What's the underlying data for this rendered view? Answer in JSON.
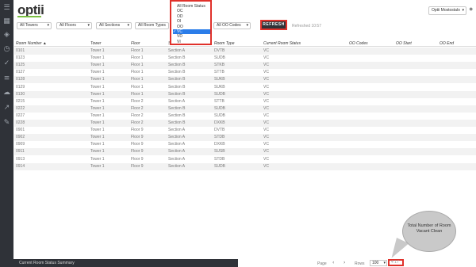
{
  "app": {
    "logo_text": "optii",
    "user_name": "Optii Mostostalo"
  },
  "rail_icons": [
    "menu-icon",
    "grid-icon",
    "layers-icon",
    "clock-icon",
    "check-circle-icon",
    "list-icon",
    "cloud-icon",
    "chart-icon",
    "wrench-icon"
  ],
  "filters": {
    "towers": "All Towers",
    "floors": "All Floors",
    "sections": "All Sections",
    "room_types": "All Room Types",
    "oo_codes": "All OO Codes"
  },
  "refresh": {
    "label": "REFRESH",
    "status": "Refreshed 10:57"
  },
  "room_status_dropdown": {
    "options": [
      "All Room Status",
      "OC",
      "OD",
      "OI",
      "OO",
      "VC",
      "VD",
      "VI"
    ],
    "selected": "VC"
  },
  "table": {
    "columns": [
      "Room Number",
      "Tower",
      "Floor",
      "Section",
      "Room Type",
      "Current Room Status",
      "OO Codes",
      "OO Start",
      "OO End"
    ],
    "sort_indicator": "▲",
    "rows": [
      [
        "0101",
        "Tower 1",
        "Floor 1",
        "Section A",
        "DVTB",
        "VC"
      ],
      [
        "0123",
        "Tower 1",
        "Floor 1",
        "Section B",
        "SUDB",
        "VC"
      ],
      [
        "0125",
        "Tower 1",
        "Floor 1",
        "Section B",
        "STKB",
        "VC"
      ],
      [
        "0127",
        "Tower 1",
        "Floor 1",
        "Section B",
        "STTB",
        "VC"
      ],
      [
        "0128",
        "Tower 1",
        "Floor 1",
        "Section B",
        "SUKB",
        "VC"
      ],
      [
        "0129",
        "Tower 1",
        "Floor 1",
        "Section B",
        "SUKB",
        "VC"
      ],
      [
        "0130",
        "Tower 1",
        "Floor 1",
        "Section B",
        "SUDB",
        "VC"
      ],
      [
        "0215",
        "Tower 1",
        "Floor 2",
        "Section A",
        "STTB",
        "VC"
      ],
      [
        "0222",
        "Tower 1",
        "Floor 2",
        "Section B",
        "SUDB",
        "VC"
      ],
      [
        "0227",
        "Tower 1",
        "Floor 2",
        "Section B",
        "SUDB",
        "VC"
      ],
      [
        "0228",
        "Tower 1",
        "Floor 2",
        "Section B",
        "DXKB",
        "VC"
      ],
      [
        "0901",
        "Tower 1",
        "Floor 9",
        "Section A",
        "DVTB",
        "VC"
      ],
      [
        "0902",
        "Tower 1",
        "Floor 9",
        "Section A",
        "STDB",
        "VC"
      ],
      [
        "0909",
        "Tower 1",
        "Floor 9",
        "Section A",
        "DXKB",
        "VC"
      ],
      [
        "0911",
        "Tower 1",
        "Floor 9",
        "Section A",
        "SUSB",
        "VC"
      ],
      [
        "0913",
        "Tower 1",
        "Floor 9",
        "Section A",
        "STDB",
        "VC"
      ],
      [
        "0914",
        "Tower 1",
        "Floor 9",
        "Section A",
        "SUDB",
        "VC"
      ]
    ]
  },
  "footer": {
    "summary_label": "Current Room Status Summary",
    "page_label": "Page",
    "prev": "‹",
    "next": "›",
    "rows_label": "Rows",
    "rows_value": "100",
    "total": "4 17"
  },
  "callout": {
    "text": "Total Number of Room Vacant Clean"
  },
  "colors": {
    "highlight": "#e0312b",
    "selected": "#2b7de9",
    "dark": "#2f3238"
  }
}
